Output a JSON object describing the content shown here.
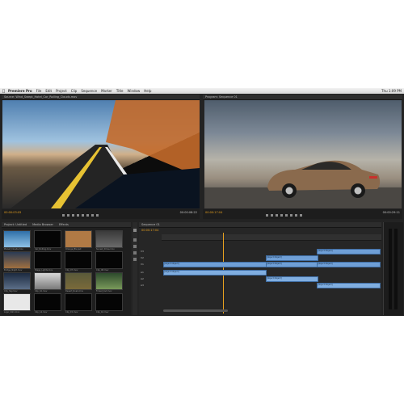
{
  "menubar": {
    "apple_icon": "apple-icon",
    "items": [
      "Premiere Pro",
      "File",
      "Edit",
      "Project",
      "Clip",
      "Sequence",
      "Marker",
      "Title",
      "Window",
      "Help"
    ],
    "clock": "Thu 1:09 PM"
  },
  "source_monitor": {
    "tab": "Source: Wind_Swept_Hotel_Car_Rolling_Clouds.mov",
    "timecode_left": "00:00:03:05",
    "timecode_right": "00:00:08:22"
  },
  "program_monitor": {
    "tab": "Program: Sequence 01",
    "timecode_left": "00:00:17:04",
    "timecode_right": "00:00:29:11"
  },
  "project_panel": {
    "tabs": [
      "Project: Untitled",
      "Media Browser",
      "Effects"
    ],
    "items": [
      {
        "label": "Planet_Clouds.mov"
      },
      {
        "label": "Car_Rolling.mov"
      },
      {
        "label": "Orange_BG.psd"
      },
      {
        "label": "Sunset_Drive.mov"
      },
      {
        "label": "Bridge_Night.mov"
      },
      {
        "label": "Stage_Lights.mov"
      },
      {
        "label": "Clip_07.mov"
      },
      {
        "label": "Clip_08.mov"
      },
      {
        "label": "City_Sky.mov"
      },
      {
        "label": "Clip_10.mov"
      },
      {
        "label": "Desert_Road.mov"
      },
      {
        "label": "Forest_Cut.mov"
      },
      {
        "label": "Logo_Intro.mov"
      },
      {
        "label": "Clip_14.mov"
      },
      {
        "label": "Clip_15.mov"
      },
      {
        "label": "Clip_16.mov"
      }
    ]
  },
  "timeline": {
    "tab": "Sequence 01",
    "timecode": "00:00:17:04",
    "tracks": [
      "V3",
      "V2",
      "V1",
      "A1",
      "A2",
      "A3"
    ],
    "clips": [
      {
        "label": "Wind_Swept_Hotel.mov [V]"
      },
      {
        "label": "City_Sky.mov"
      },
      {
        "label": "Car_Rolling.mov"
      },
      {
        "label": "Sunset_Drive.mov [V]"
      },
      {
        "label": "Car_Rolling.mov [V]"
      },
      {
        "label": "Wind_Swept_Hotel.mov [A]"
      },
      {
        "label": "Sunset_Drive.mov [A]"
      },
      {
        "label": "Car_Rolling.mov [A]"
      }
    ]
  }
}
